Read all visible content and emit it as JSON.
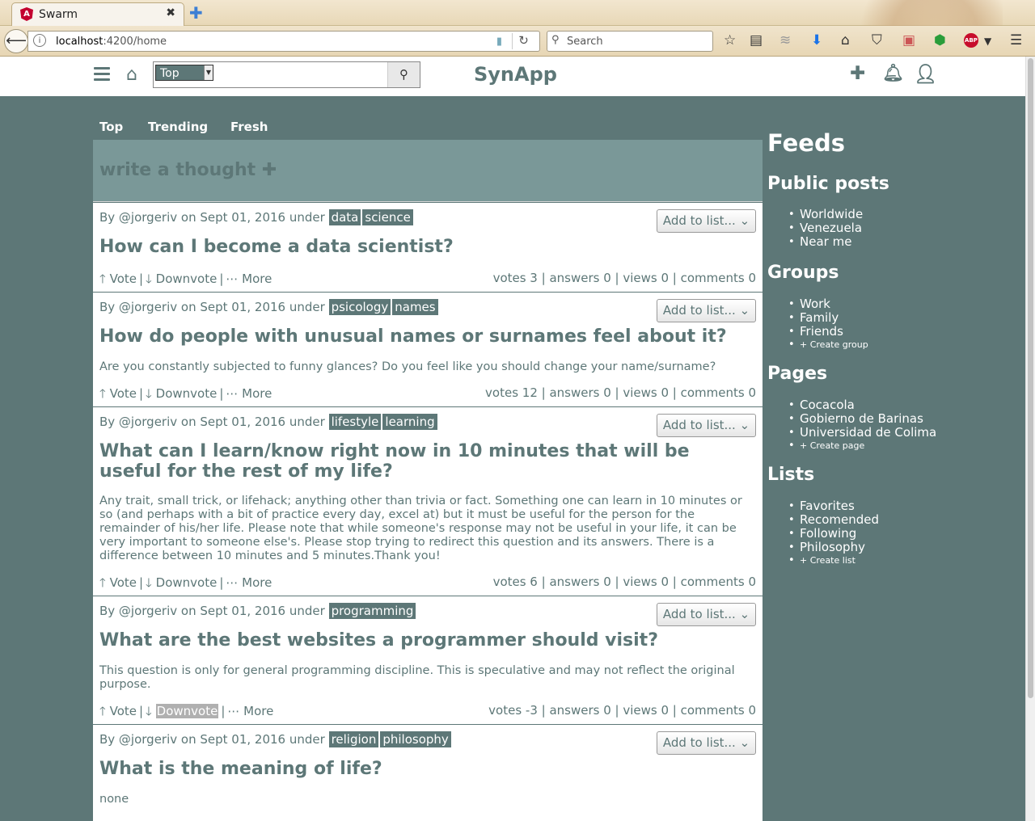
{
  "browser": {
    "tab_title": "Swarm",
    "tab_close": "✖",
    "new_tab": "✚",
    "url_host": "localhost",
    "url_path": ":4200/home",
    "search_placeholder": "Search"
  },
  "header": {
    "search_type": "Top",
    "brand": "SynApp"
  },
  "tabs": [
    "Top",
    "Trending",
    "Fresh"
  ],
  "compose": {
    "label": "write a thought ✚"
  },
  "posts": [
    {
      "by": "By @jorgeriv on Sept 01, 2016 under",
      "tags": [
        "data",
        "science"
      ],
      "add_list": "Add to list... ⌄",
      "title": "How can I become a data scientist?",
      "body": "",
      "vote": "Vote",
      "downvote": "Downvote",
      "more": "More",
      "stats": "votes 3 | answers 0 | views 0 | comments 0"
    },
    {
      "by": "By @jorgeriv on Sept 01, 2016 under",
      "tags": [
        "psicology",
        "names"
      ],
      "add_list": "Add to list... ⌄",
      "title": "How do people with unusual names or surnames feel about it?",
      "body": "Are you constantly subjected to funny glances? Do you feel like you should change your name/surname?",
      "vote": "Vote",
      "downvote": "Downvote",
      "more": "More",
      "stats": "votes 12 | answers 0 | views 0 | comments 0"
    },
    {
      "by": "By @jorgeriv on Sept 01, 2016 under",
      "tags": [
        "lifestyle",
        "learning"
      ],
      "add_list": "Add to list... ⌄",
      "title": "What can I learn/know right now in 10 minutes that will be useful for the rest of my life?",
      "body": "Any trait, small trick, or lifehack; anything other than trivia or fact. Something one can learn in 10 minutes or so (and perhaps with a bit of practice every day, excel at) but it must be useful for the person for the remainder of his/her life. Please note that while someone's response may not be useful in your life, it can be very important to someone else's. Please stop trying to redirect this question and its answers. There is a difference between 10 minutes and 5 minutes.Thank you!",
      "vote": "Vote",
      "downvote": "Downvote",
      "more": "More",
      "stats": "votes 6 | answers 0 | views 0 | comments 0"
    },
    {
      "by": "By @jorgeriv on Sept 01, 2016 under",
      "tags": [
        "programming"
      ],
      "add_list": "Add to list... ⌄",
      "title": "What are the best websites a programmer should visit?",
      "body": "This question is only for general programming discipline. This is speculative and may not reflect the original purpose.",
      "vote": "Vote",
      "downvote": "Downvote",
      "more": "More",
      "stats": "votes -3 | answers 0 | views 0 | comments 0"
    },
    {
      "by": "By @jorgeriv on Sept 01, 2016 under",
      "tags": [
        "religion",
        "philosophy"
      ],
      "add_list": "Add to list... ⌄",
      "title": "What is the meaning of life?",
      "body": "none",
      "vote": "",
      "downvote": "",
      "more": "",
      "stats": ""
    }
  ],
  "sidebar": {
    "title": "Feeds",
    "public": {
      "heading": "Public posts",
      "items": [
        "Worldwide",
        "Venezuela",
        "Near me"
      ]
    },
    "groups": {
      "heading": "Groups",
      "items": [
        "Work",
        "Family",
        "Friends"
      ],
      "create": "+ Create group"
    },
    "pages": {
      "heading": "Pages",
      "items": [
        "Cocacola",
        "Gobierno de Barinas",
        "Universidad de Colima"
      ],
      "create": "+ Create page"
    },
    "lists": {
      "heading": "Lists",
      "items": [
        "Favorites",
        "Recomended",
        "Following",
        "Philosophy"
      ],
      "create": "+ Create list"
    }
  },
  "colors": {
    "brand": "#5d7777",
    "compose_bg": "#7a9898"
  }
}
